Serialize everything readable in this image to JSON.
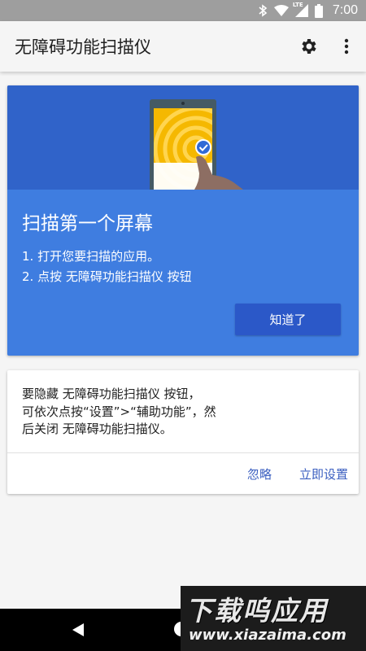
{
  "status_bar": {
    "time": "7:00",
    "icons": [
      "bluetooth-icon",
      "wifi-icon",
      "lte-signal-icon",
      "battery-icon"
    ],
    "lte_label": "LTE",
    "background": "#9e9e9e"
  },
  "app_bar": {
    "title": "无障碍功能扫描仪",
    "actions": [
      "settings-icon",
      "more-vert-icon"
    ]
  },
  "intro_card": {
    "title": "扫描第一个屏幕",
    "steps": [
      "1. 打开您要扫描的应用。",
      "2. 点按 无障碍功能扫描仪 按钮"
    ],
    "got_it_label": "知道了",
    "colors": {
      "header": "#3063c9",
      "body": "#3f7de0",
      "button": "#2b58c8",
      "phone_screen": "#f5b800"
    }
  },
  "notice_card": {
    "text_lines": [
      "要隐藏 无障碍功能扫描仪 按钮，",
      "可依次点按“设置”>“辅助功能”，然",
      "后关闭 无障碍功能扫描仪。"
    ],
    "ignore_label": "忽略",
    "setup_label": "立即设置",
    "action_color": "#3b5fc0"
  },
  "nav_bar": {
    "buttons": [
      "back-icon",
      "home-icon"
    ]
  },
  "watermark": {
    "title": "下载呜应用",
    "url": "www.xiazaima.com"
  }
}
